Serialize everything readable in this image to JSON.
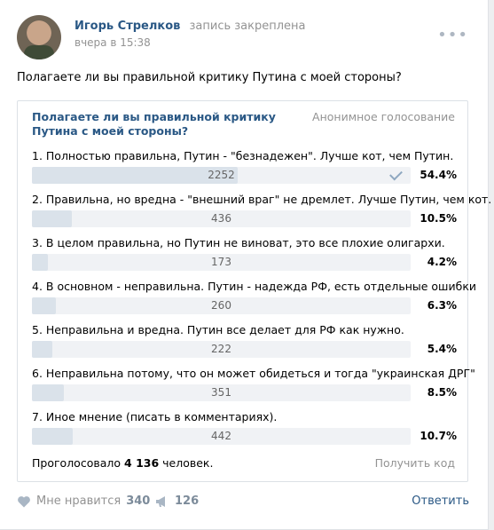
{
  "post": {
    "author": "Игорь Стрелков",
    "pinned": "запись закреплена",
    "time": "вчера в 15:38",
    "question": "Полагаете ли вы правильной критику Путина с моей стороны?"
  },
  "poll": {
    "title": "Полагаете ли вы правильной критику Путина с моей стороны?",
    "type": "Анонимное голосование",
    "options": [
      {
        "label": "1. Полностью правильна, Путин - \"безнадежен\". Лучше кот, чем Путин.",
        "count": "2252",
        "percent": "54.4%",
        "share": 0.544,
        "chosen": true
      },
      {
        "label": "2. Правильна, но вредна - \"внешний враг\" не дремлет. Лучше Путин, чем кот.",
        "count": "436",
        "percent": "10.5%",
        "share": 0.105,
        "chosen": false
      },
      {
        "label": "3. В целом правильна, но Путин не виноват, это все плохие олигархи.",
        "count": "173",
        "percent": "4.2%",
        "share": 0.042,
        "chosen": false
      },
      {
        "label": "4. В основном - неправильна. Путин - надежда РФ, есть отдельные ошибки",
        "count": "260",
        "percent": "6.3%",
        "share": 0.063,
        "chosen": false
      },
      {
        "label": "5. Неправильна и вредна. Путин все делает для РФ как нужно.",
        "count": "222",
        "percent": "5.4%",
        "share": 0.054,
        "chosen": false
      },
      {
        "label": "6. Неправильна потому, что он может обидеться и тогда \"украинская ДРГ\"",
        "count": "351",
        "percent": "8.5%",
        "share": 0.085,
        "chosen": false
      },
      {
        "label": "7. Иное мнение (писать в комментариях).",
        "count": "442",
        "percent": "10.7%",
        "share": 0.107,
        "chosen": false
      }
    ],
    "voted_prefix": "Проголосовало",
    "voted_count": "4 136",
    "voted_suffix": "человек.",
    "get_code": "Получить код"
  },
  "actions": {
    "like_label": "Мне нравится",
    "like_count": "340",
    "share_count": "126",
    "reply_label": "Ответить"
  },
  "colors": {
    "link": "#2a5885",
    "bar_fill": "#dae2ea",
    "bar_bg": "#f0f2f5",
    "muted": "#939393"
  }
}
